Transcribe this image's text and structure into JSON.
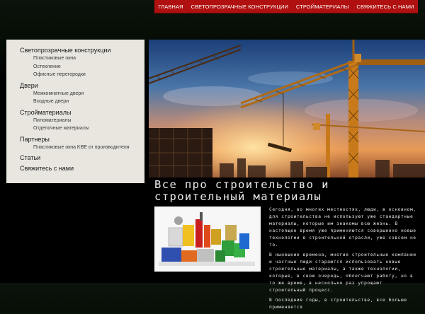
{
  "nav": {
    "items": [
      {
        "label": "ГЛАВНАЯ"
      },
      {
        "label": "СВЕТОПРОЗРАЧНЫЕ КОНСТРУКЦИИ"
      },
      {
        "label": "СТРОЙМАТЕРИАЛЫ"
      },
      {
        "label": "СВЯЖИТЕСЬ С НАМИ"
      }
    ]
  },
  "sidebar": {
    "categories": [
      {
        "label": "Светопрозрачные конструкции",
        "items": [
          "Пластиковые окна",
          "Остекление",
          "Офисные перегородки"
        ]
      },
      {
        "label": "Двери",
        "items": [
          "Межкомнатные двери",
          "Входные двери"
        ]
      },
      {
        "label": "Стройматериалы",
        "items": [
          "Пиломатериалы",
          "Отделочные материалы"
        ]
      },
      {
        "label": "Партнеры",
        "items": [
          "Пластиковые окна KBE от производителя"
        ]
      },
      {
        "label": "Статьи",
        "items": []
      },
      {
        "label": "Свяжитесь с нами",
        "items": []
      }
    ]
  },
  "main": {
    "headline": "Все про строительство и строительный материалы",
    "paragraphs": [
      "Сегодня, во многих местностях, люди, в основном, для строительства не используют уже стандартные материалы, которые им знакомы всю жизнь. В настоящее время уже применяются совершенно новые технологии в строительной отрасли, уже совсем не то.",
      "В нынешние времена, многие строительные компании и частные люди стараются использовать новые строительные материалы, а также технологии, которые, в свою очередь, облегчают работу, но в то же время, в несколько раз упрощают строительный процесс.",
      "В последние годы, в строительстве, все больше применяется"
    ]
  },
  "colors": {
    "nav_bg": "#b01010",
    "sidebar_bg": "#e8e6df",
    "page_bg": "#000000"
  }
}
